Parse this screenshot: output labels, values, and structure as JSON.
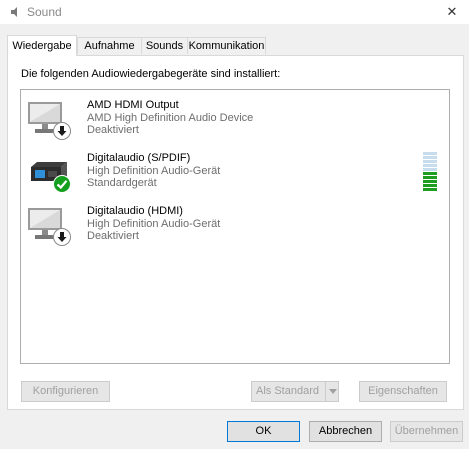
{
  "window": {
    "title": "Sound",
    "close_glyph": "✕"
  },
  "tabs": [
    {
      "label": "Wiedergabe",
      "active": true
    },
    {
      "label": "Aufnahme",
      "active": false
    },
    {
      "label": "Sounds",
      "active": false
    },
    {
      "label": "Kommunikation",
      "active": false
    }
  ],
  "panel": {
    "intro": "Die folgenden Audiowiedergabegeräte sind installiert:",
    "devices": [
      {
        "name": "AMD HDMI Output",
        "description": "AMD High Definition Audio Device",
        "status": "Deaktiviert",
        "icon": "monitor-icon",
        "badge": "down-arrow-badge-icon"
      },
      {
        "name": "Digitalaudio (S/PDIF)",
        "description": "High Definition Audio-Gerät",
        "status": "Standardgerät",
        "icon": "digital-audio-icon",
        "badge": "check-badge-icon"
      },
      {
        "name": "Digitalaudio (HDMI)",
        "description": "High Definition Audio-Gerät",
        "status": "Deaktiviert",
        "icon": "monitor-icon",
        "badge": "down-arrow-badge-icon"
      }
    ],
    "level_meter": {
      "level": 0.5,
      "active_color": "#1e9e1e",
      "inactive_color": "#c7dcec"
    },
    "buttons": {
      "configure": "Konfigurieren",
      "set_default": "Als Standard",
      "properties": "Eigenschaften"
    }
  },
  "footer": {
    "ok": "OK",
    "cancel": "Abbrechen",
    "apply": "Übernehmen"
  },
  "colors": {
    "accent": "#0078d7",
    "check_green": "#14a01e"
  }
}
